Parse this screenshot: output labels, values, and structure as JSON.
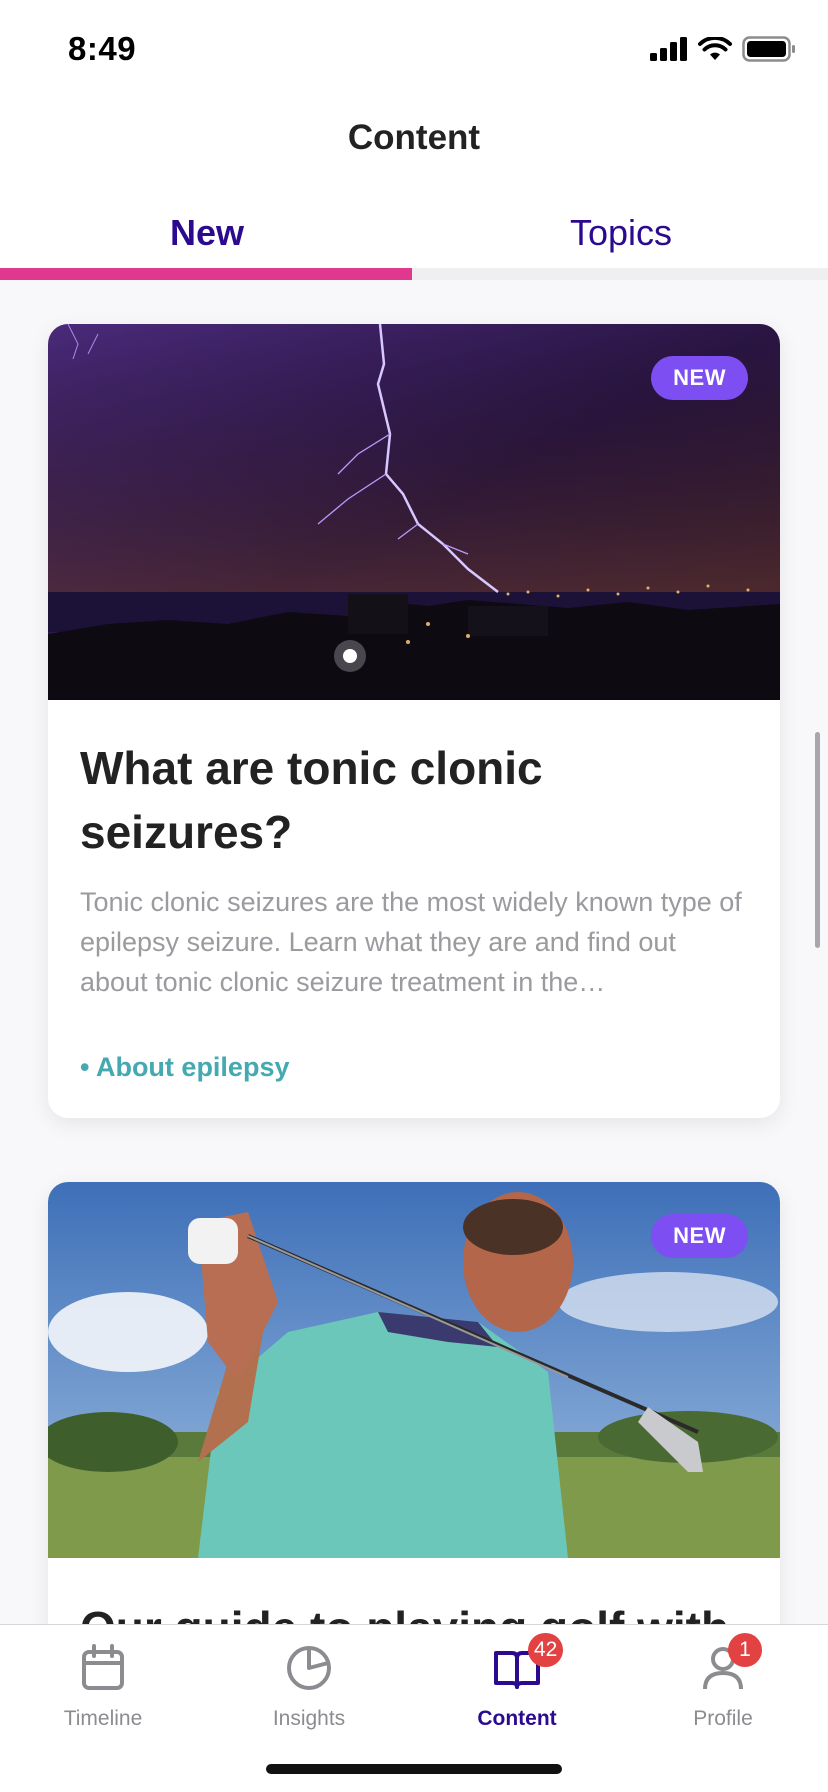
{
  "status_bar": {
    "time": "8:49"
  },
  "header": {
    "title": "Content"
  },
  "tabs": [
    {
      "label": "New",
      "active": true
    },
    {
      "label": "Topics",
      "active": false
    }
  ],
  "accent_colors": {
    "tab_indicator": "#e0378f",
    "tab_text": "#2c0a8f",
    "badge_new": "#7d4ef2",
    "tag": "#44a9b0",
    "count_badge": "#e34242"
  },
  "cards": [
    {
      "badge": "NEW",
      "image": "lightning-storm-over-city",
      "title": "What are tonic clonic seizures?",
      "description": "Tonic clonic seizures are the most widely known type of epilepsy seizure. Learn what they are and find out about tonic clonic seizure treatment in the…",
      "tag": "• About epilepsy"
    },
    {
      "badge": "NEW",
      "image": "man-playing-golf",
      "title": "Our guide to playing golf with"
    }
  ],
  "bottom_nav": {
    "items": [
      {
        "label": "Timeline",
        "icon": "calendar-icon"
      },
      {
        "label": "Insights",
        "icon": "pie-chart-icon"
      },
      {
        "label": "Content",
        "icon": "book-icon",
        "badge": "42",
        "active": true
      },
      {
        "label": "Profile",
        "icon": "person-icon",
        "badge": "1"
      }
    ]
  }
}
